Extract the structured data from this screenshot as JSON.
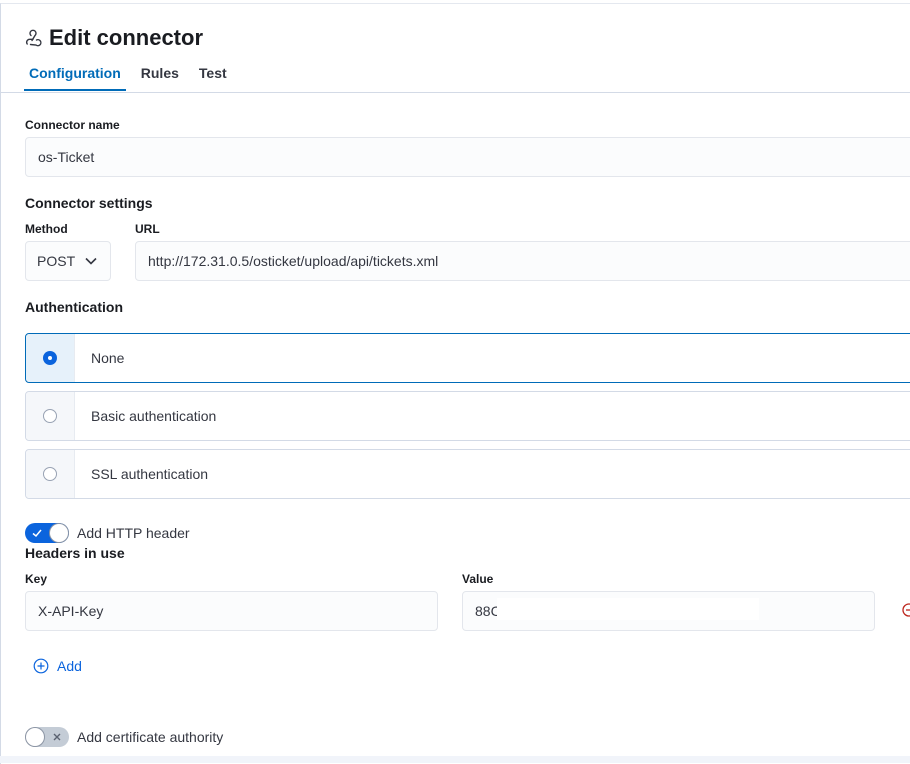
{
  "header": {
    "title": "Edit connector",
    "icon": "webhook-icon"
  },
  "tabs": [
    {
      "label": "Configuration",
      "active": true
    },
    {
      "label": "Rules",
      "active": false
    },
    {
      "label": "Test",
      "active": false
    }
  ],
  "connector_name": {
    "label": "Connector name",
    "value": "os-Ticket"
  },
  "settings": {
    "title": "Connector settings",
    "method_label": "Method",
    "method_value": "POST",
    "url_label": "URL",
    "url_value": "http://172.31.0.5/osticket/upload/api/tickets.xml"
  },
  "authentication": {
    "title": "Authentication",
    "options": [
      {
        "label": "None",
        "selected": true
      },
      {
        "label": "Basic authentication",
        "selected": false
      },
      {
        "label": "SSL authentication",
        "selected": false
      }
    ]
  },
  "http_header": {
    "toggle_label": "Add HTTP header",
    "enabled": true,
    "headers_title": "Headers in use",
    "key_label": "Key",
    "value_label": "Value",
    "key_value": "X-API-Key",
    "value_value": "88C",
    "add_label": "Add"
  },
  "certificate": {
    "toggle_label": "Add certificate authority",
    "enabled": false
  },
  "colors": {
    "accent": "#006bb8",
    "switch_on": "#0b64dd",
    "danger": "#bd271e"
  }
}
